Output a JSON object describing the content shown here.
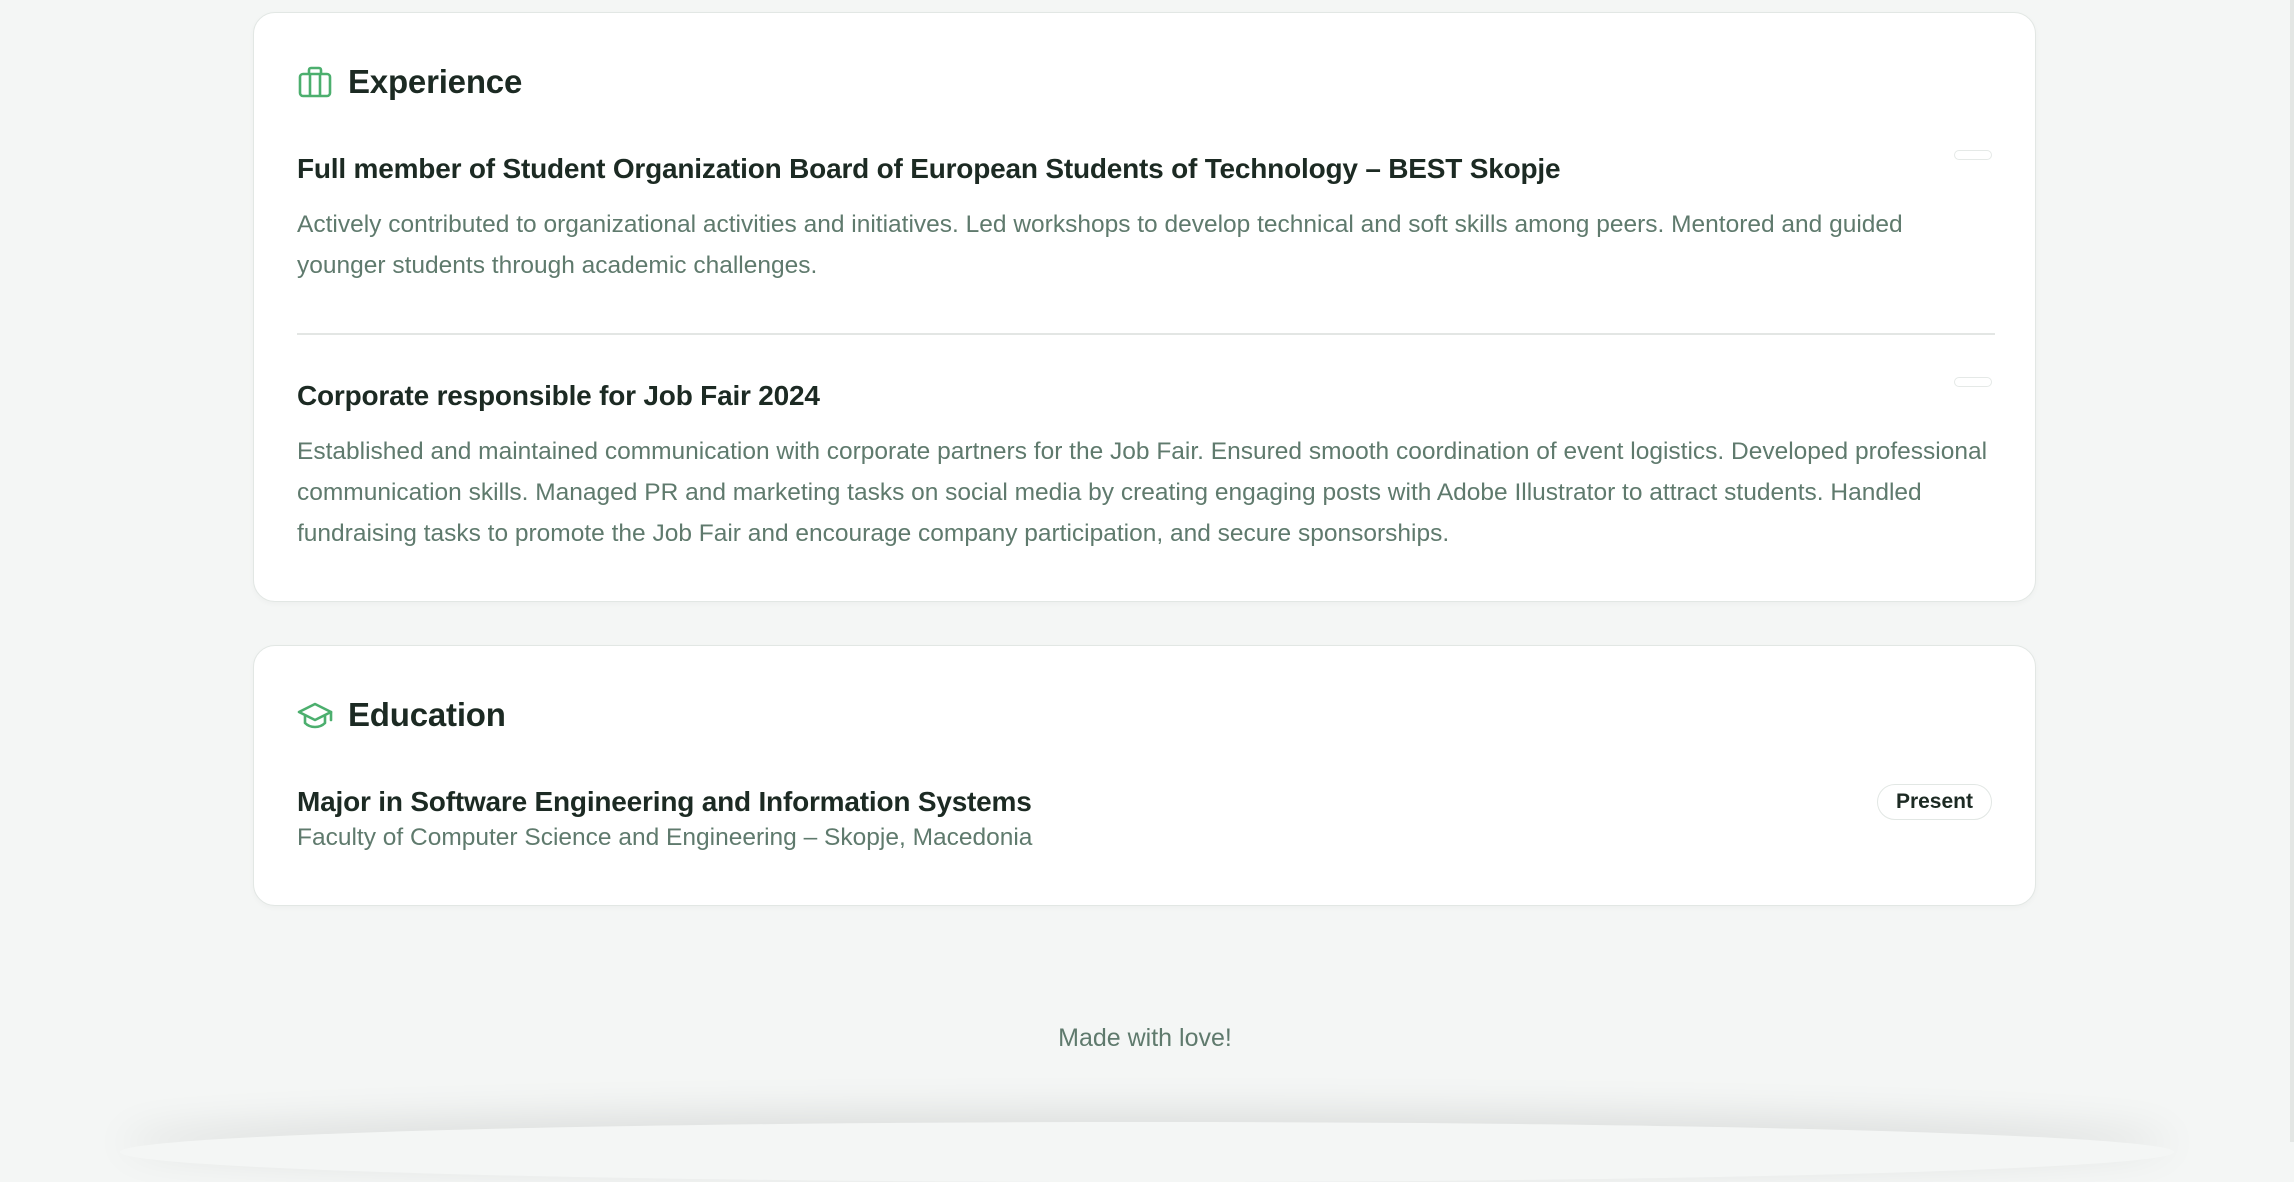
{
  "experience": {
    "icon": "briefcase-icon",
    "title": "Experience",
    "items": [
      {
        "title": "Full member of Student Organization Board of European Students of Technology – BEST Skopje",
        "description": "Actively contributed to organizational activities and initiatives. Led workshops to develop technical and soft skills among peers. Mentored and guided younger students through academic challenges."
      },
      {
        "title": "Corporate responsible for Job Fair 2024",
        "description": "Established and maintained communication with corporate partners for the Job Fair. Ensured smooth coordination of event logistics. Developed professional communication skills. Managed PR and marketing tasks on social media by creating engaging posts with Adobe Illustrator to attract students. Handled fundraising tasks to promote the Job Fair and encourage company participation, and secure sponsorships."
      }
    ]
  },
  "education": {
    "icon": "graduation-cap-icon",
    "title": "Education",
    "items": [
      {
        "title": "Major in Software Engineering and Information Systems",
        "institution": "Faculty of Computer Science and Engineering – Skopje, Macedonia",
        "badge": "Present"
      }
    ]
  },
  "footer": {
    "text": "Made with love!"
  },
  "colors": {
    "accent": "#4caf6e",
    "background": "#f4f6f5",
    "text_primary": "#1c2a23",
    "text_muted": "#5f7a6d"
  }
}
